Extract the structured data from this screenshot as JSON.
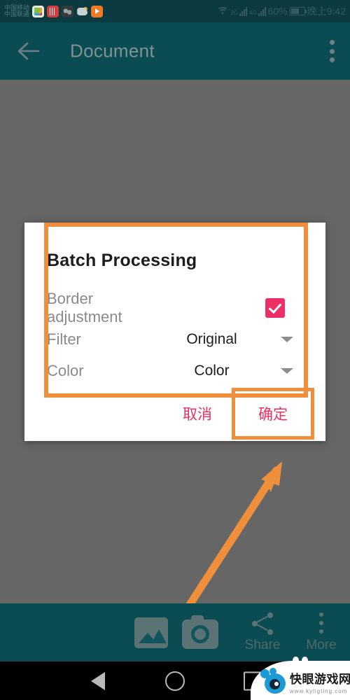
{
  "status_bar": {
    "carrier_lines": [
      "中国移动",
      "中国联通"
    ],
    "app_icons": [
      "photos-icon",
      "video-app-icon",
      "social-app-icon",
      "weather-icon",
      "media-player-icon"
    ],
    "wifi_icon": "wifi-icon",
    "signal_1_label": "3G",
    "signal_2_label": "4G",
    "battery_percent": "60%",
    "battery_icon": "battery-icon",
    "clock": "晚上9:42"
  },
  "app_bar": {
    "back_icon": "back-arrow-icon",
    "title": "Document",
    "overflow_icon": "overflow-menu-icon"
  },
  "dialog": {
    "title": "Batch Processing",
    "rows": [
      {
        "label": "Border adjustment",
        "type": "checkbox",
        "checked": true
      },
      {
        "label": "Filter",
        "type": "dropdown",
        "value": "Original"
      },
      {
        "label": "Color",
        "type": "dropdown",
        "value": "Color"
      }
    ],
    "cancel_label": "取消",
    "ok_label": "确定",
    "accent_color": "#ec2f64",
    "highlight_color": "#ef8f3c"
  },
  "annotation": {
    "arrow_icon": "annotation-arrow-icon",
    "color": "#ef8f3c"
  },
  "bottom_toolbar": {
    "gallery_icon": "gallery-icon",
    "camera_icon": "camera-icon",
    "share_icon": "share-icon",
    "share_label": "Share",
    "more_icon": "more-icon",
    "more_label": "More"
  },
  "nav_bar": {
    "back_icon": "nav-back-icon",
    "home_icon": "nav-home-icon",
    "recents_icon": "nav-recents-icon"
  },
  "watermark": {
    "logo_icon": "kuaiyan-logo-icon",
    "site_name": "快眼游戏网",
    "site_url": "www.kyligting.com"
  }
}
